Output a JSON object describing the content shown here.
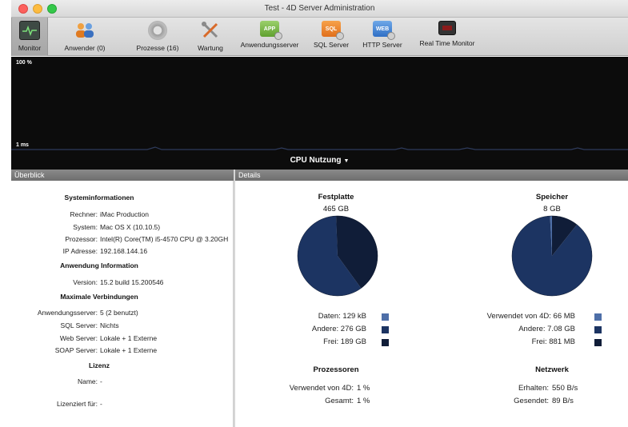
{
  "window": {
    "title": "Test - 4D Server Administration"
  },
  "toolbar": {
    "items": [
      {
        "label": "Monitor",
        "icon": "monitor-icon"
      },
      {
        "label": "Anwender (0)",
        "icon": "users-icon"
      },
      {
        "label": "Prozesse (16)",
        "icon": "processes-icon"
      },
      {
        "label": "Wartung",
        "icon": "maintenance-icon"
      },
      {
        "label": "Anwendungsserver",
        "icon": "app-server-icon",
        "badge": "APP"
      },
      {
        "label": "SQL Server",
        "icon": "sql-server-icon",
        "badge": "SQL"
      },
      {
        "label": "HTTP Server",
        "icon": "http-server-icon",
        "badge": "WEB"
      },
      {
        "label": "Real Time Monitor",
        "icon": "real-time-monitor-icon"
      }
    ]
  },
  "graph": {
    "top_label": "100 %",
    "bottom_label": "1 ms",
    "selector_label": "CPU Nutzung",
    "caret": "▼"
  },
  "left": {
    "header": "Überblick",
    "system_title": "Systeminformationen",
    "rechner_key": "Rechner:",
    "rechner_val": "iMac Production",
    "system_key": "System:",
    "system_val": "Mac OS X (10.10.5)",
    "prozessor_key": "Prozessor:",
    "prozessor_val": "Intel(R) Core(TM) i5-4570 CPU @ 3.20GH",
    "ip_key": "IP Adresse:",
    "ip_val": "192.168.144.16",
    "app_title": "Anwendung Information",
    "version_key": "Version:",
    "version_val": "15.2 build 15.200546",
    "conn_title": "Maximale Verbindungen",
    "appserver_key": "Anwendungsserver:",
    "appserver_val": "5 (2 benutzt)",
    "sqlserver_key": "SQL Server:",
    "sqlserver_val": "Nichts",
    "webserver_key": "Web Server:",
    "webserver_val": "Lokale + 1 Externe",
    "soapserver_key": "SOAP Server:",
    "soapserver_val": "Lokale + 1 Externe",
    "license_title": "Lizenz",
    "name_key": "Name:",
    "name_val": "-",
    "licensed_key": "Lizenziert für:",
    "licensed_val": "-"
  },
  "details": {
    "header": "Details",
    "disk": {
      "title": "Festplatte",
      "total": "465 GB",
      "legend": [
        {
          "label": "Daten:",
          "value": "129 kB",
          "color": "#4e6fa8",
          "fraction": 0.0
        },
        {
          "label": "Andere:",
          "value": "276 GB",
          "color": "#1c3462",
          "fraction": 0.594
        },
        {
          "label": "Frei:",
          "value": "189 GB",
          "color": "#101d38",
          "fraction": 0.406
        }
      ]
    },
    "memory": {
      "title": "Speicher",
      "total": "8 GB",
      "legend": [
        {
          "label": "Verwendet von 4D:",
          "value": "66 MB",
          "color": "#4e6fa8",
          "fraction": 0.008
        },
        {
          "label": "Andere:",
          "value": "7.08 GB",
          "color": "#1c3462",
          "fraction": 0.885
        },
        {
          "label": "Frei:",
          "value": "881 MB",
          "color": "#101d38",
          "fraction": 0.107
        }
      ]
    },
    "processors": {
      "title": "Prozessoren",
      "used_key": "Verwendet von 4D:",
      "used_val": "1 %",
      "total_key": "Gesamt:",
      "total_val": "1 %"
    },
    "network": {
      "title": "Netzwerk",
      "recv_key": "Erhalten:",
      "recv_val": "550 B/s",
      "sent_key": "Gesendet:",
      "sent_val": "89 B/s"
    }
  }
}
